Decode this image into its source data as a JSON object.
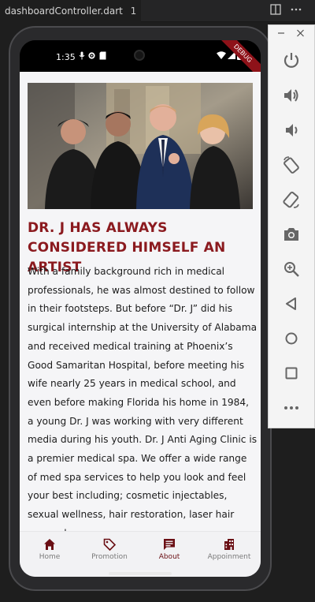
{
  "ide": {
    "tab_title": "dashboardController.dart",
    "tab_badge": "1"
  },
  "status_bar": {
    "time": "1:35",
    "debug_label": "DEBUG"
  },
  "article": {
    "image_alt": "Group photo of four people",
    "heading": "DR. J HAS ALWAYS CONSIDERED HIMSELF AN ARTIST",
    "body": "With a family background rich in medical professionals, he was almost destined to follow in their footsteps. But before “Dr. J” did his surgical internship at the University of Alabama and received medical training at Phoenix’s Good Samaritan Hospital, before meeting his wife nearly 25 years in medical school, and even before making Florida his home in 1984, a young Dr. J was working with very different media during his youth. Dr. J Anti Aging Clinic is a premier medical spa. We offer a wide range of med spa services to help you look and feel your best including; cosmetic injectables, sexual wellness, hair restoration, laser hair removal,"
  },
  "nav": {
    "items": [
      {
        "label": "Home",
        "icon": "home-icon",
        "active": false
      },
      {
        "label": "Promotion",
        "icon": "tag-icon",
        "active": false
      },
      {
        "label": "About",
        "icon": "chat-icon",
        "active": true
      },
      {
        "label": "Appoinment",
        "icon": "building-icon",
        "active": false
      }
    ]
  },
  "emulator_toolbar": {
    "buttons": [
      "power-icon",
      "volume-up-icon",
      "volume-down-icon",
      "rotate-left-icon",
      "rotate-right-icon",
      "camera-icon",
      "zoom-icon",
      "back-icon",
      "home-circle-icon",
      "overview-icon",
      "more-icon"
    ]
  },
  "colors": {
    "brand": "#8b1a1f",
    "active_nav": "#6a0f14",
    "inactive_nav": "#7a7a7a"
  }
}
